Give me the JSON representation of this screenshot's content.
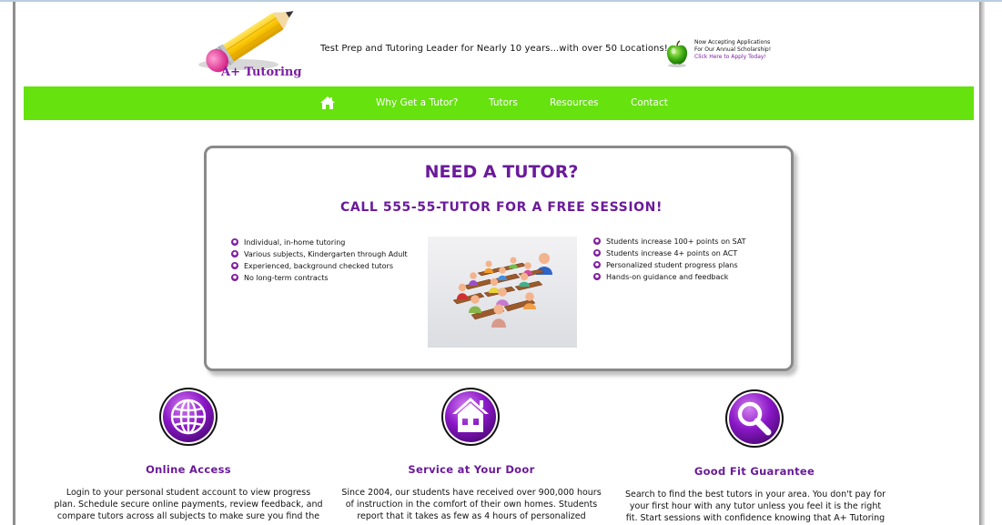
{
  "header": {
    "logo_text": "A+ Tutoring",
    "tagline": "Test Prep and Tutoring Leader for Nearly 10 years...with over 50 Locations!",
    "scholarship": {
      "line1": "Now Accepting Applications",
      "line2": "For Our Annual Scholarship!",
      "link": "Click Here to Apply Today!"
    }
  },
  "nav": {
    "home_icon": "home-icon",
    "items": [
      {
        "label": "Why Get a Tutor?"
      },
      {
        "label": "Tutors"
      },
      {
        "label": "Resources"
      },
      {
        "label": "Contact"
      }
    ]
  },
  "hero": {
    "heading": "NEED A TUTOR?",
    "subheading": "CALL 555-55-TUTOR FOR A FREE SESSION!",
    "left_bullets": [
      "Individual, in-home tutoring",
      "Various subjects, Kindergarten through Adult",
      "Experienced, background checked tutors",
      "No long-term contracts"
    ],
    "right_bullets": [
      "Students increase 100+ points on SAT",
      "Students increase 4+ points on ACT",
      "Personalized student progress plans",
      "Hands-on guidance and feedback"
    ]
  },
  "features": [
    {
      "icon": "globe-icon",
      "title": "Online Access",
      "body": [
        "Login to your personal student account to view progress",
        "plan. Schedule secure online payments, review feedback, and",
        "compare tutors across all subjects to make sure you find the"
      ]
    },
    {
      "icon": "house-icon",
      "title": "Service at Your Door",
      "body": [
        "Since 2004, our students have received over 900,000 hours",
        "of instruction in the comfort of their own homes. Students",
        "report that it takes as few as 4 hours of personalized"
      ]
    },
    {
      "icon": "magnifier-icon",
      "title": "Good Fit Guarantee",
      "body": [
        "Search to find the best tutors in your area. You don't pay for",
        "your first hour with any tutor unless you feel it is the right",
        "fit. Start sessions with confidence knowing that A+ Tutoring"
      ]
    }
  ],
  "colors": {
    "nav_green": "#66e20e",
    "brand_purple": "#6a1b9a",
    "frame_gray": "#8a8a8a"
  }
}
